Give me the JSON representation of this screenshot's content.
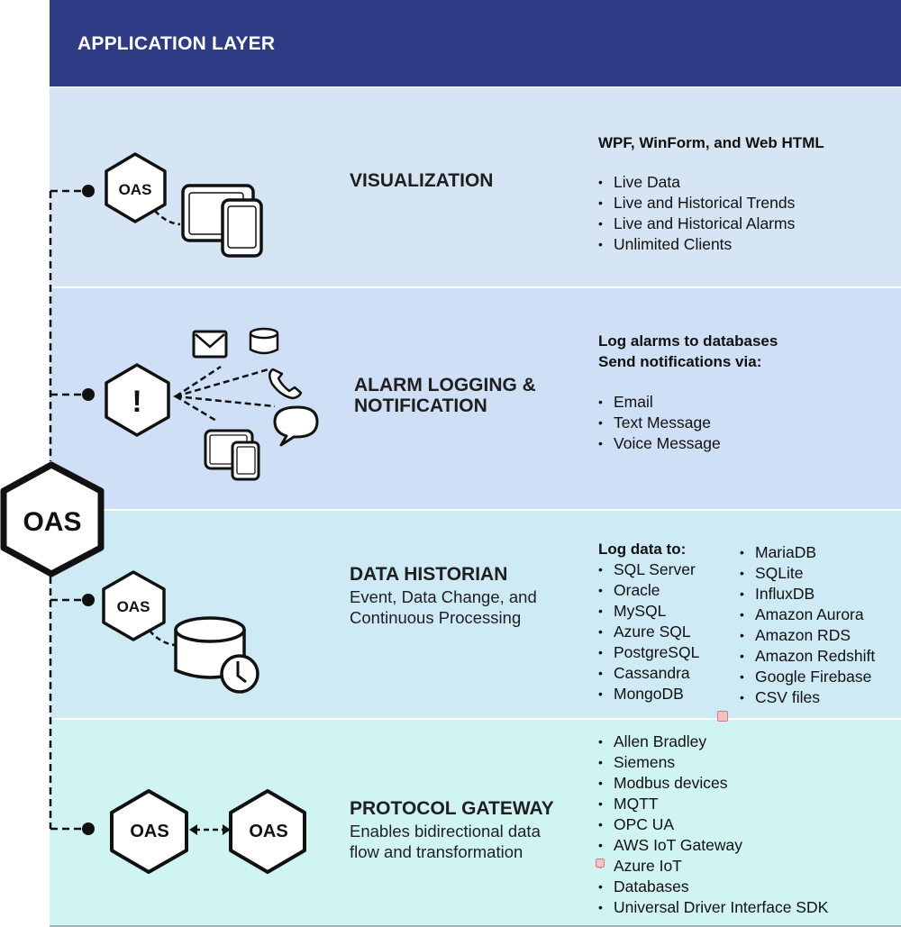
{
  "header": {
    "title": "APPLICATION LAYER"
  },
  "hub": {
    "label": "OAS"
  },
  "colors": {
    "header_bg": "#2e3c86",
    "visualization_bg": "#d6e5f4",
    "alarm_bg": "#cfdff5",
    "historian_bg": "#cdeaf5",
    "gateway_bg": "#cff4f1"
  },
  "sections": {
    "visualization": {
      "title": "VISUALIZATION",
      "node_label": "OAS",
      "list_heading": "WPF, WinForm, and Web HTML",
      "items": [
        "Live Data",
        "Live and Historical Trends",
        "Live and Historical Alarms",
        "Unlimited Clients"
      ]
    },
    "alarm": {
      "title_line1": "ALARM LOGGING &",
      "title_line2": "NOTIFICATION",
      "node_label": "!",
      "list_heading_line1": "Log alarms to databases",
      "list_heading_line2": "Send notifications via:",
      "items": [
        "Email",
        "Text Message",
        "Voice Message"
      ]
    },
    "historian": {
      "title": "DATA HISTORIAN",
      "subtitle_line1": "Event, Data Change, and",
      "subtitle_line2": "Continuous Processing",
      "node_label": "OAS",
      "list_heading": "Log data to:",
      "items_col1": [
        "SQL Server",
        "Oracle",
        "MySQL",
        "Azure SQL",
        "PostgreSQL",
        "Cassandra",
        "MongoDB"
      ],
      "items_col2": [
        "MariaDB",
        "SQLite",
        "InfluxDB",
        "Amazon Aurora",
        "Amazon RDS",
        "Amazon Redshift",
        "Google Firebase",
        "CSV files"
      ]
    },
    "gateway": {
      "title": "PROTOCOL GATEWAY",
      "subtitle_line1": "Enables bidirectional data",
      "subtitle_line2": "flow and transformation",
      "node_left_label": "OAS",
      "node_right_label": "OAS",
      "items": [
        "Allen Bradley",
        "Siemens",
        "Modbus devices",
        "MQTT",
        "OPC UA",
        "AWS IoT Gateway",
        "Azure IoT",
        "Databases",
        "Universal Driver Interface SDK"
      ]
    }
  }
}
